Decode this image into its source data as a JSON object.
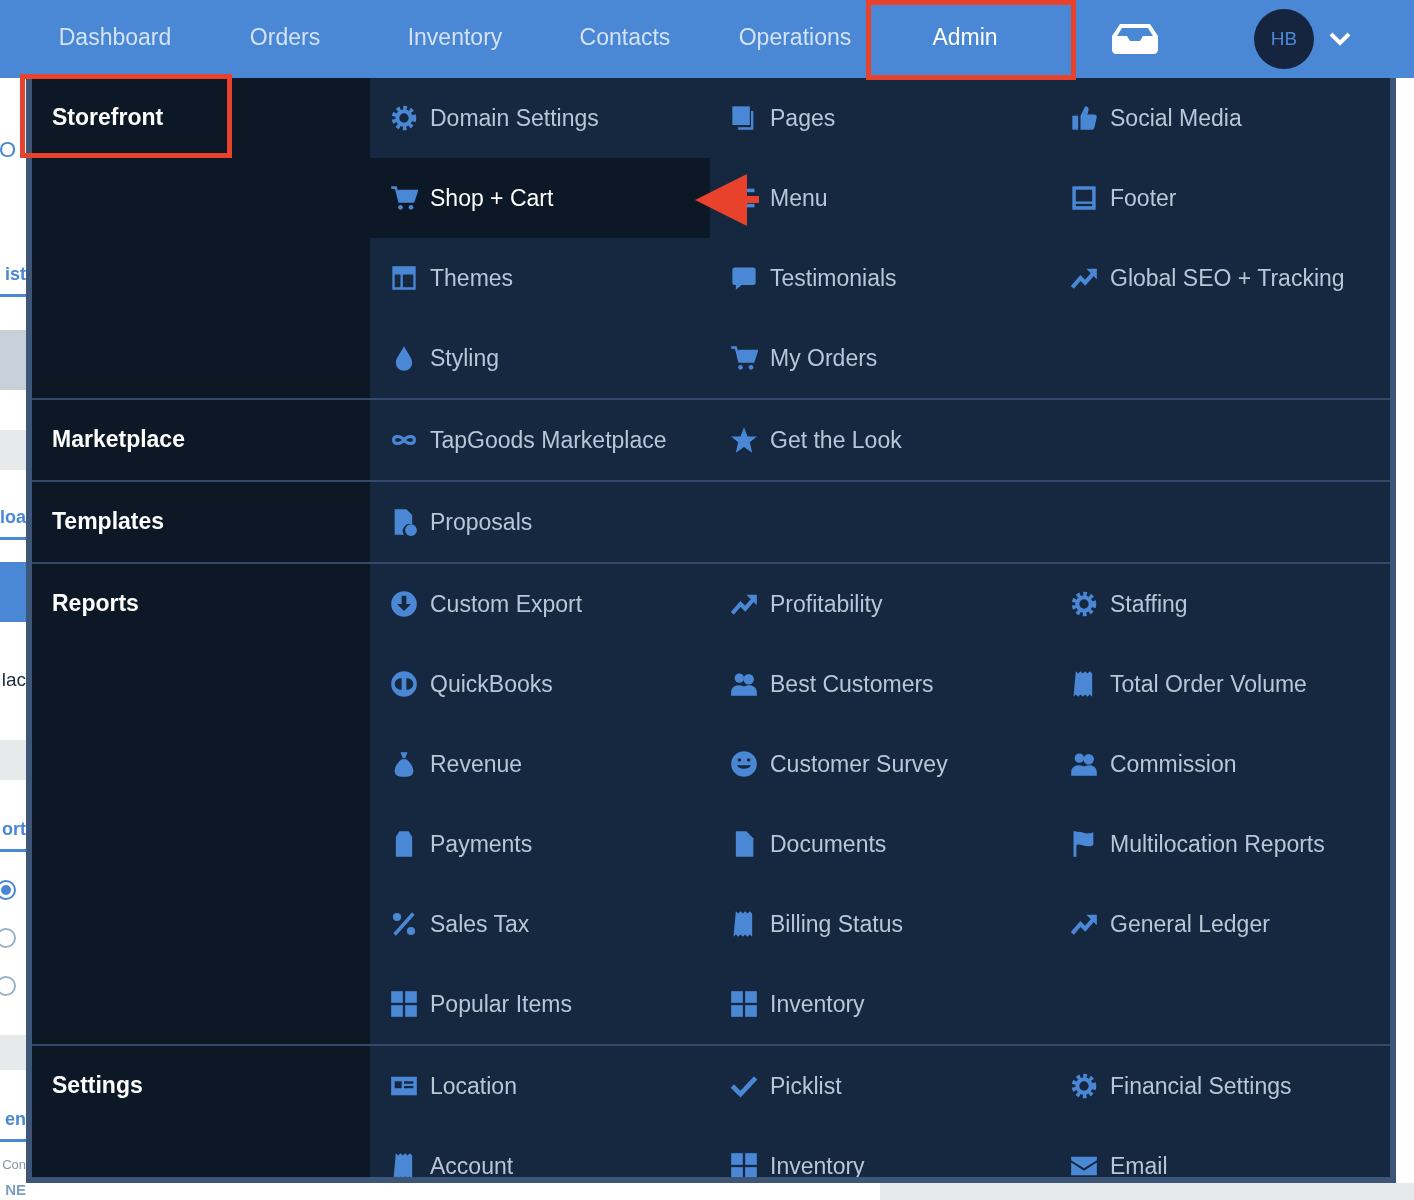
{
  "nav": {
    "tabs": [
      {
        "label": "Dashboard",
        "selected": false
      },
      {
        "label": "Orders",
        "selected": false
      },
      {
        "label": "Inventory",
        "selected": false
      },
      {
        "label": "Contacts",
        "selected": false
      },
      {
        "label": "Operations",
        "selected": false
      },
      {
        "label": "Admin",
        "selected": true
      }
    ],
    "user": {
      "initials": "HB"
    }
  },
  "background_page": {
    "fragments": [
      {
        "kind": "title",
        "text": "O"
      },
      {
        "kind": "tab",
        "text": "ist"
      },
      {
        "kind": "tab",
        "text": "loa"
      },
      {
        "kind": "plain",
        "text": "lac"
      },
      {
        "kind": "tab",
        "text": "ort"
      },
      {
        "kind": "tab",
        "text": "en"
      },
      {
        "kind": "caption",
        "text": "Con"
      },
      {
        "kind": "label",
        "text": "NE"
      }
    ],
    "radios": [
      {
        "selected": true
      },
      {
        "selected": false
      },
      {
        "selected": false
      }
    ]
  },
  "menu": {
    "sections": [
      {
        "heading": "Storefront",
        "items": [
          {
            "label": "Domain Settings",
            "selected": false
          },
          {
            "label": "Pages",
            "selected": false
          },
          {
            "label": "Social Media",
            "selected": false
          },
          {
            "label": "Shop + Cart",
            "selected": true
          },
          {
            "label": "Menu",
            "selected": false
          },
          {
            "label": "Footer",
            "selected": false
          },
          {
            "label": "Themes",
            "selected": false
          },
          {
            "label": "Testimonials",
            "selected": false
          },
          {
            "label": "Global SEO + Tracking",
            "selected": false
          },
          {
            "label": "Styling",
            "selected": false
          },
          {
            "label": "My Orders",
            "selected": false
          }
        ]
      },
      {
        "heading": "Marketplace",
        "items": [
          {
            "label": "TapGoods Marketplace",
            "selected": false
          },
          {
            "label": "Get the Look",
            "selected": false
          }
        ]
      },
      {
        "heading": "Templates",
        "items": [
          {
            "label": "Proposals",
            "selected": false
          }
        ]
      },
      {
        "heading": "Reports",
        "items": [
          {
            "label": "Custom Export",
            "selected": false
          },
          {
            "label": "Profitability",
            "selected": false
          },
          {
            "label": "Staffing",
            "selected": false
          },
          {
            "label": "QuickBooks",
            "selected": false
          },
          {
            "label": "Best Customers",
            "selected": false
          },
          {
            "label": "Total Order Volume",
            "selected": false
          },
          {
            "label": "Revenue",
            "selected": false
          },
          {
            "label": "Customer Survey",
            "selected": false
          },
          {
            "label": "Commission",
            "selected": false
          },
          {
            "label": "Payments",
            "selected": false
          },
          {
            "label": "Documents",
            "selected": false
          },
          {
            "label": "Multilocation Reports",
            "selected": false
          },
          {
            "label": "Sales Tax",
            "selected": false
          },
          {
            "label": "Billing Status",
            "selected": false
          },
          {
            "label": "General Ledger",
            "selected": false
          },
          {
            "label": "Popular Items",
            "selected": false
          },
          {
            "label": "Inventory",
            "selected": false
          }
        ]
      },
      {
        "heading": "Settings",
        "items": [
          {
            "label": "Location",
            "selected": false
          },
          {
            "label": "Picklist",
            "selected": false
          },
          {
            "label": "Financial Settings",
            "selected": false
          },
          {
            "label": "Account",
            "selected": false
          },
          {
            "label": "Inventory",
            "selected": false
          },
          {
            "label": "Email",
            "selected": false
          }
        ]
      }
    ]
  }
}
